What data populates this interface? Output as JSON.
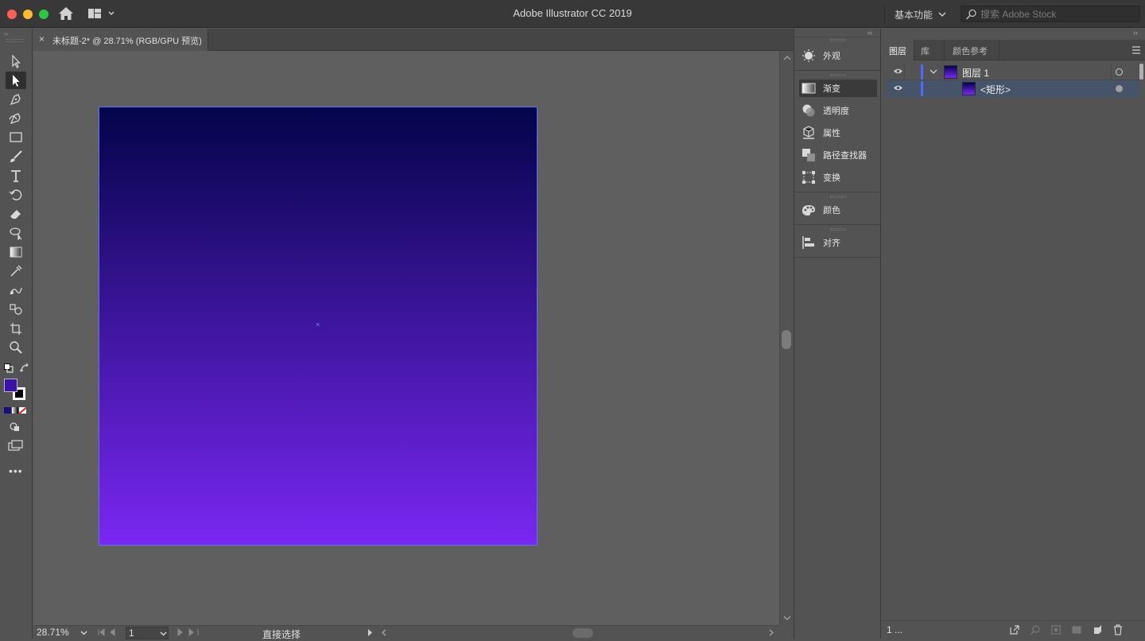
{
  "window": {
    "title": "Adobe Illustrator CC 2019"
  },
  "header": {
    "workspace_label": "基本功能",
    "search_placeholder": "搜索 Adobe Stock"
  },
  "document": {
    "tab_title": "未标题-2* @ 28.71% (RGB/GPU 预览)",
    "close_glyph": "×"
  },
  "artboard": {
    "gradient_start": "#03044a",
    "gradient_end": "#7a27f2",
    "center_mark": "×"
  },
  "statusbar": {
    "zoom": "28.71%",
    "artboard_number": "1",
    "tool_name": "直接选择"
  },
  "panel_strip": {
    "items": [
      {
        "label": "外观",
        "icon": "appearance-icon"
      },
      {
        "label": "渐变",
        "icon": "gradient-icon",
        "active": true
      },
      {
        "label": "透明度",
        "icon": "transparency-icon"
      },
      {
        "label": "属性",
        "icon": "properties-icon"
      },
      {
        "label": "路径查找器",
        "icon": "pathfinder-icon"
      },
      {
        "label": "变换",
        "icon": "transform-icon"
      },
      {
        "label": "颜色",
        "icon": "color-icon"
      },
      {
        "label": "对齐",
        "icon": "align-icon"
      }
    ]
  },
  "layers_panel": {
    "tabs": [
      "图层",
      "库",
      "颜色参考"
    ],
    "active_tab": 0,
    "layer_name": "图层 1",
    "object_name": "<矩形>",
    "layer_count": "1 ...",
    "layer_color": "#4f6bff"
  },
  "colors": {
    "fill": "#3a14a8",
    "ui_bg": "#535353",
    "canvas_bg": "#5f5f5f"
  }
}
